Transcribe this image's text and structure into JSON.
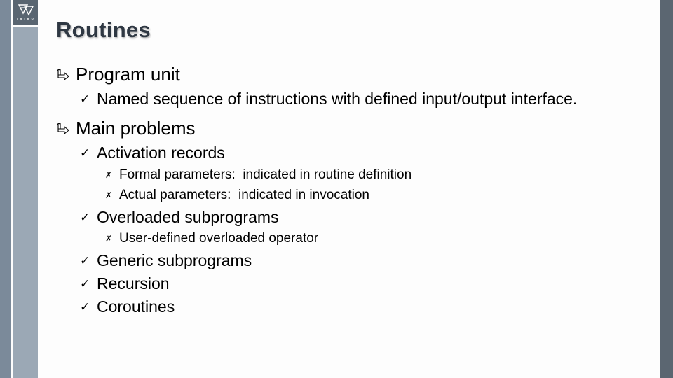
{
  "slide": {
    "title": "Routines",
    "logo": {
      "icon": "university-logo-icon",
      "text": "I B I B O"
    },
    "colors": {
      "left_bar": "#7b8a9a",
      "logo_box": "#596571",
      "light_bar": "#9ba8b5",
      "right_bar": "#5b6671",
      "title": "#2f3843"
    },
    "bullets": {
      "level1_icon": "hook-arrow-icon",
      "level2_icon": "check-icon",
      "level3_icon": "cross-icon",
      "level2_glyph": "✓",
      "level3_glyph": "✗"
    },
    "items": [
      {
        "text": "Program unit"
      },
      {
        "text": "Named sequence of instructions with defined input/output interface."
      },
      {
        "text": "Main problems"
      },
      {
        "text": "Activation records"
      },
      {
        "text": "Formal parameters:  indicated in routine definition"
      },
      {
        "text": "Actual parameters:  indicated in invocation"
      },
      {
        "text": "Overloaded subprograms"
      },
      {
        "text": "User-defined overloaded operator"
      },
      {
        "text": "Generic subprograms"
      },
      {
        "text": "Recursion"
      },
      {
        "text": "Coroutines"
      }
    ]
  }
}
